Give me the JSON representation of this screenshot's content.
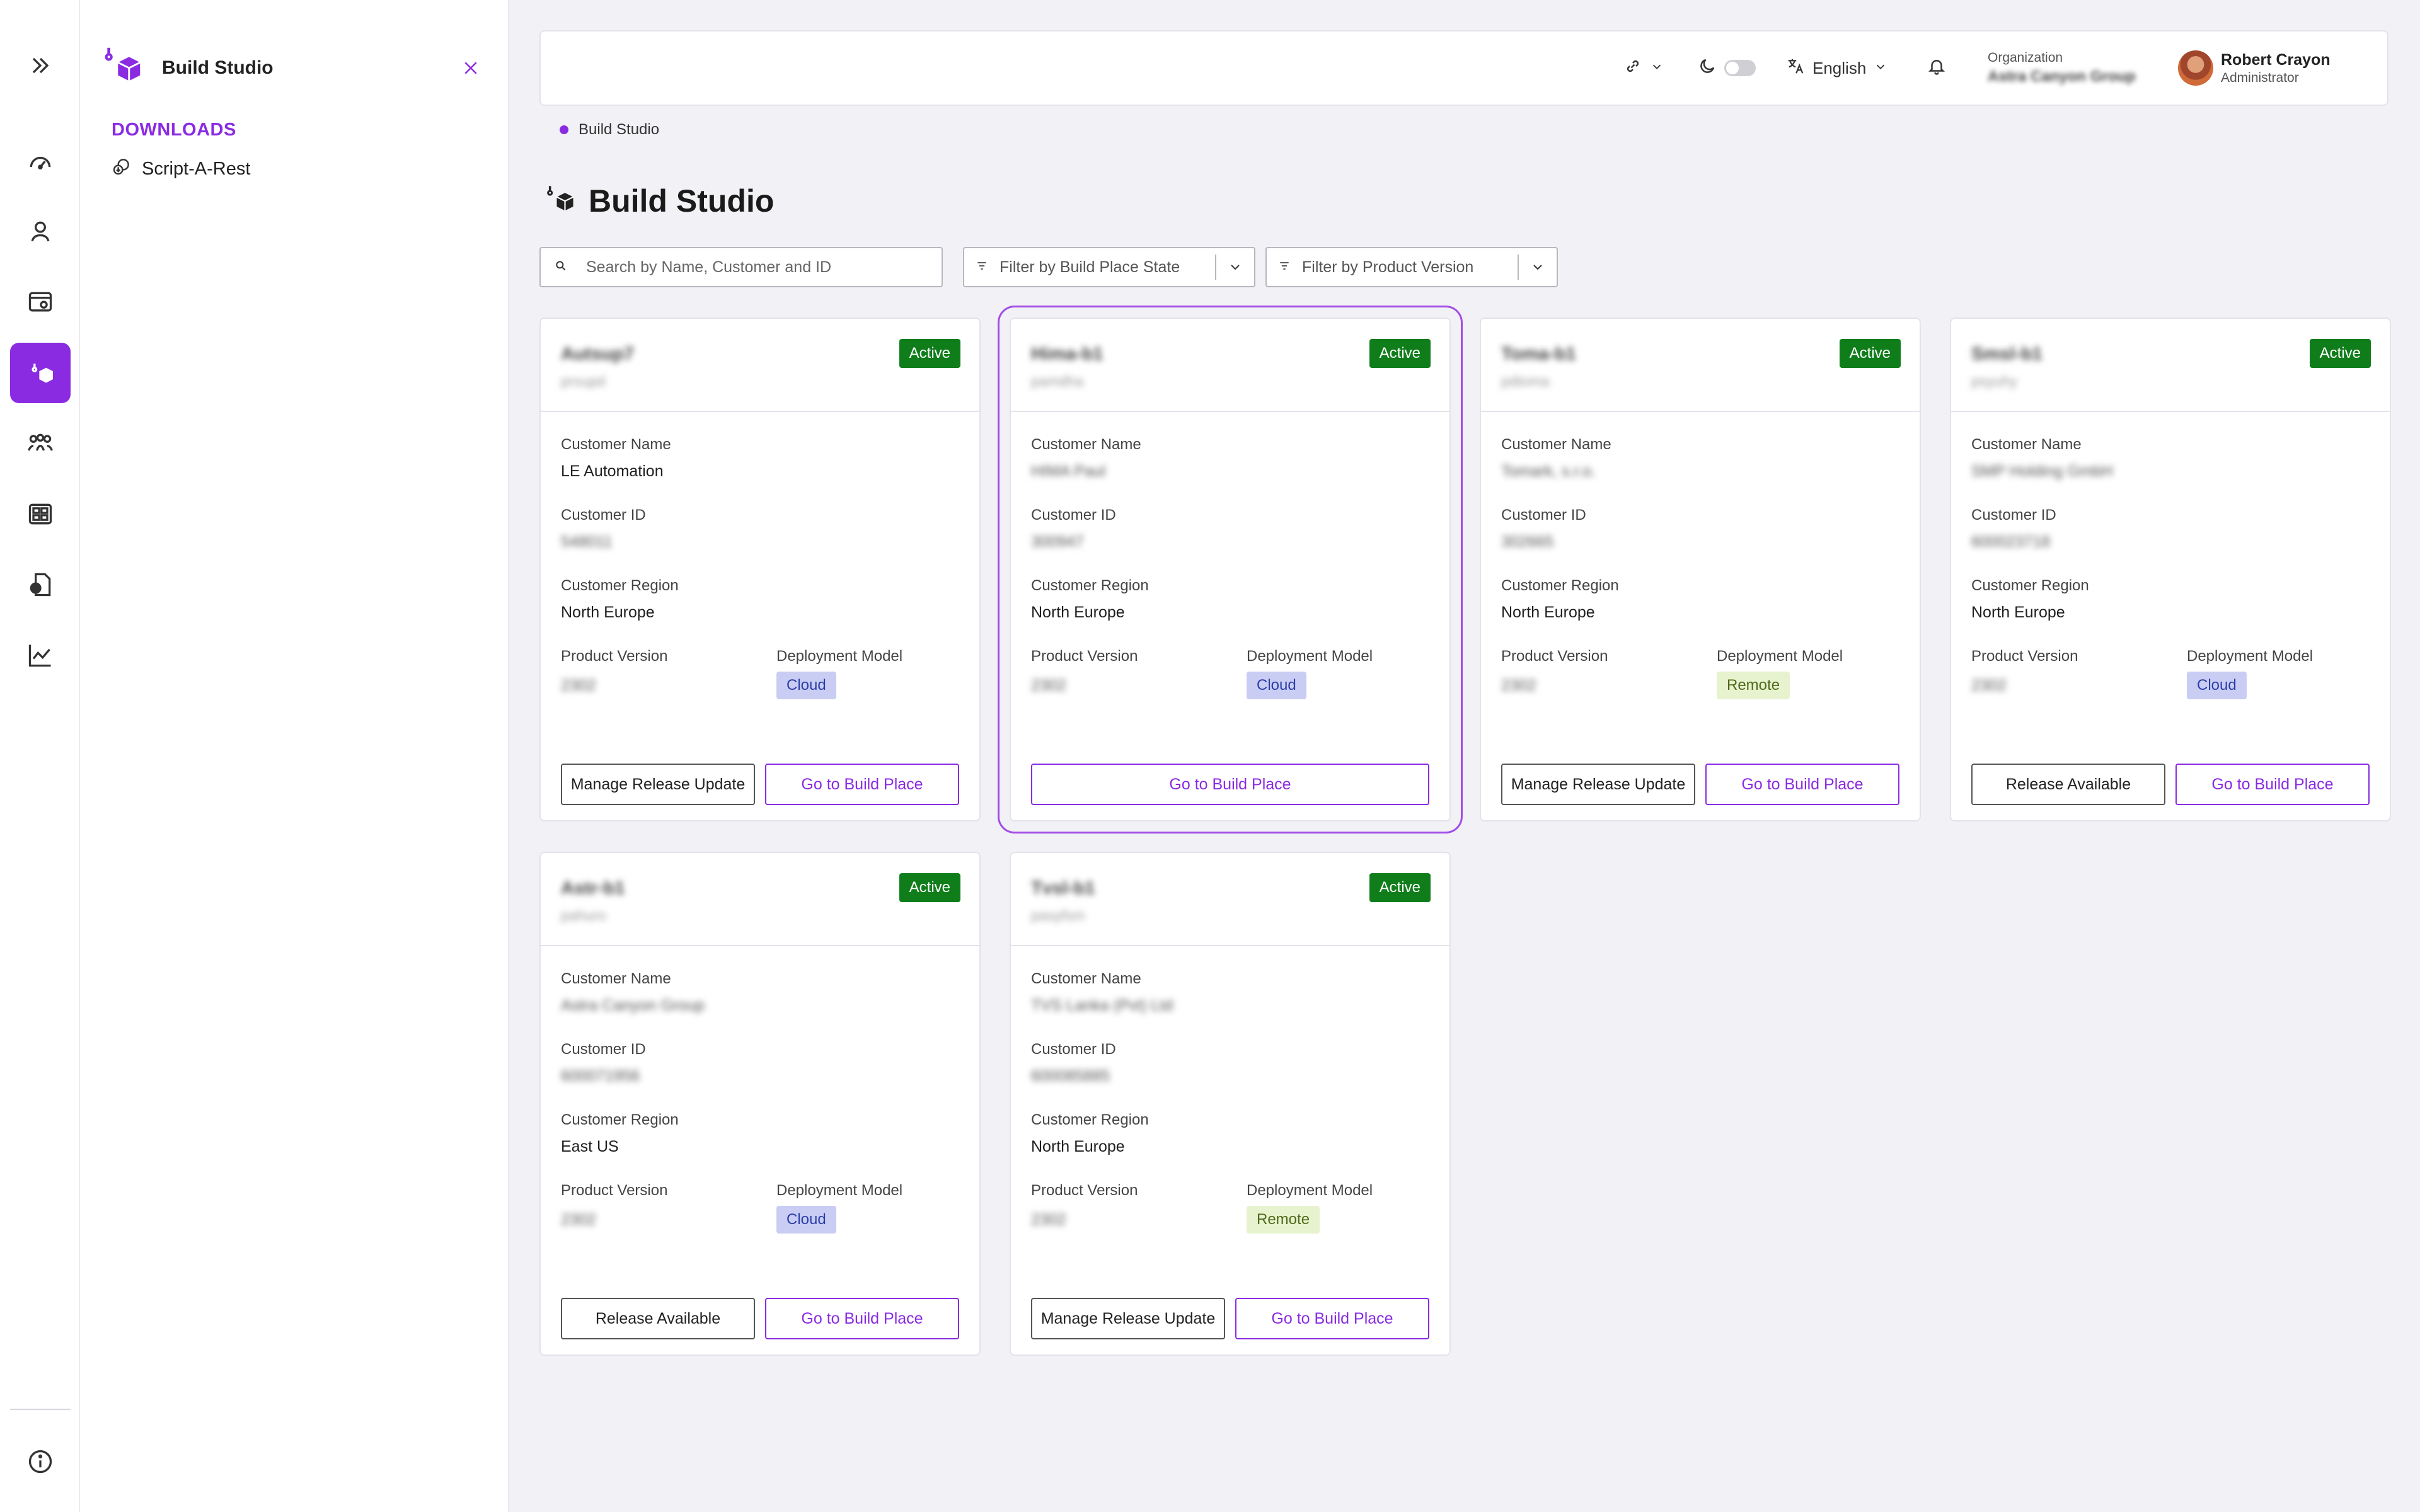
{
  "panel": {
    "title": "Build Studio",
    "section": "DOWNLOADS",
    "items": [
      {
        "label": "Script-A-Rest"
      }
    ]
  },
  "topbar": {
    "language": "English",
    "org_label": "Organization",
    "org_value": "Astra Canyon Group",
    "user_name": "Robert Crayon",
    "user_role": "Administrator"
  },
  "breadcrumb": "Build Studio",
  "page_title": "Build Studio",
  "filters": {
    "search_placeholder": "Search by Name, Customer and ID",
    "state_placeholder": "Filter by Build Place State",
    "version_placeholder": "Filter by Product Version"
  },
  "labels": {
    "customer_name": "Customer Name",
    "customer_id": "Customer ID",
    "customer_region": "Customer Region",
    "product_version": "Product Version",
    "deployment_model": "Deployment Model"
  },
  "cards": [
    {
      "name": "Autsup7",
      "sub": "prsupd",
      "status": "Active",
      "customer_name": "LE Automation",
      "customer_id": "548011",
      "region": "North Europe",
      "version": "2302",
      "deployment": "Cloud",
      "btn_primary": "Manage Release Update",
      "btn_go": "Go to Build Place"
    },
    {
      "name": "Hima-b1",
      "sub": "pamdha",
      "status": "Active",
      "customer_name": "HIMA Paul",
      "customer_id": "300947",
      "region": "North Europe",
      "version": "2302",
      "deployment": "Cloud",
      "btn_go": "Go to Build Place"
    },
    {
      "name": "Toma-b1",
      "sub": "pdtoma",
      "status": "Active",
      "customer_name": "Tomark, s.r.o.",
      "customer_id": "302665",
      "region": "North Europe",
      "version": "2302",
      "deployment": "Remote",
      "btn_primary": "Manage Release Update",
      "btn_go": "Go to Build Place"
    },
    {
      "name": "Smsl-b1",
      "sub": "psyuhy",
      "status": "Active",
      "customer_name": "SMP Holding GmbH",
      "customer_id": "600023718",
      "region": "North Europe",
      "version": "2302",
      "deployment": "Cloud",
      "btn_primary": "Release Available",
      "btn_go": "Go to Build Place"
    },
    {
      "name": "Astr-b1",
      "sub": "pahuro",
      "status": "Active",
      "customer_name": "Astra Canyon Group",
      "customer_id": "600071956",
      "region": "East US",
      "version": "2302",
      "deployment": "Cloud",
      "btn_primary": "Release Available",
      "btn_go": "Go to Build Place"
    },
    {
      "name": "Tvsl-b1",
      "sub": "pasyfsm",
      "status": "Active",
      "customer_name": "TVS Lanka (Pvt) Ltd",
      "customer_id": "600085885",
      "region": "North Europe",
      "version": "2302",
      "deployment": "Remote",
      "btn_primary": "Manage Release Update",
      "btn_go": "Go to Build Place"
    }
  ]
}
